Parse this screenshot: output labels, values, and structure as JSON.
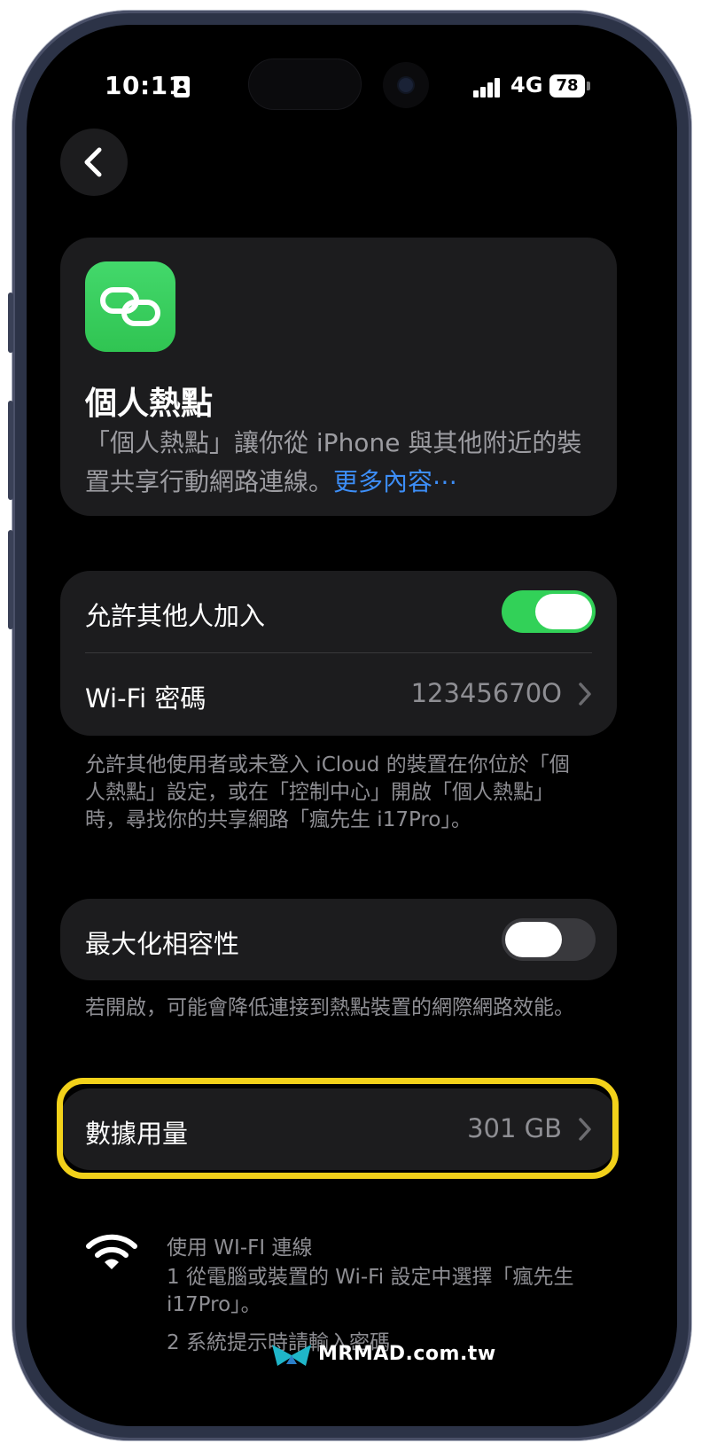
{
  "status_bar": {
    "time": "10:11",
    "network": "4G",
    "battery": "78"
  },
  "info_card": {
    "title": "個人熱點",
    "description": "「個人熱點」讓你從 iPhone 與其他附近的裝置共享行動網路連線。",
    "more_link": "更多內容⋯"
  },
  "allow_others": {
    "label": "允許其他人加入",
    "enabled": true
  },
  "wifi_password": {
    "label": "Wi-Fi 密碼",
    "value": "12345670O"
  },
  "footnote_allow": "允許其他使用者或未登入 iCloud 的裝置在你位於「個人熱點」設定，或在「控制中心」開啟「個人熱點」時，尋找你的共享網路「瘋先生 i17Pro」。",
  "maximize_compat": {
    "label": "最大化相容性",
    "enabled": false
  },
  "footnote_compat": "若開啟，可能會降低連接到熱點裝置的網際網路效能。",
  "data_usage": {
    "label": "數據用量",
    "value": "301 GB"
  },
  "wifi_help": {
    "title": "使用 WI-FI 連線",
    "step1": "1 從電腦或裝置的 Wi-Fi 設定中選擇「瘋先生 i17Pro」。",
    "step2": "2 系統提示時請輸入密碼"
  },
  "watermark": "MRMAD.com.tw",
  "colors": {
    "accent_blue": "#3d8ef7",
    "toggle_green": "#32d158",
    "highlight_yellow": "#f2d11a",
    "card_bg": "#1c1c1e"
  }
}
